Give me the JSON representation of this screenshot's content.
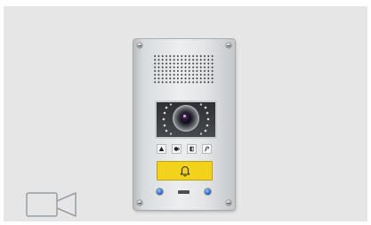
{
  "product": {
    "panel_finish": "stainless-steel",
    "colors": {
      "call_button": "#f3d21c",
      "indicator_led": "#2c6fd0",
      "background": "#e6e6e6",
      "video_icon_stroke": "#9a9ea3"
    },
    "status_icons": [
      "alarm-bell-icon",
      "door-chime-icon",
      "door-open-icon",
      "hearing-loop-icon"
    ],
    "call_button_icon": "bell-icon"
  },
  "toolbar": {
    "video_icon": "video-camera-icon"
  }
}
